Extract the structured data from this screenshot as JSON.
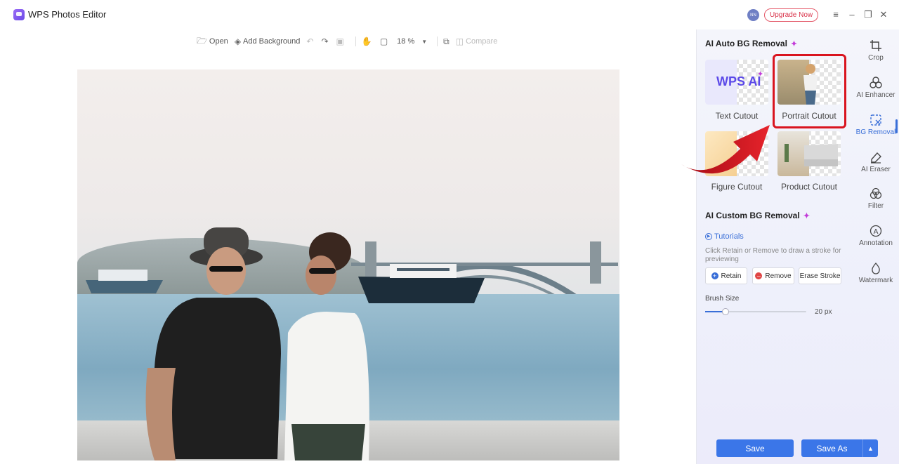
{
  "app": {
    "title": "WPS Photos Editor",
    "avatar_initials": "NN",
    "upgrade_label": "Upgrade Now",
    "window_controls": [
      "menu-icon",
      "minimize-icon",
      "restore-icon",
      "close-icon"
    ]
  },
  "toolbar": {
    "open_label": "Open",
    "add_background_label": "Add Background",
    "zoom_value": "18 %",
    "compare_label": "Compare",
    "icons": [
      "open-icon",
      "add-background-icon",
      "undo-icon",
      "redo-icon",
      "image-icon",
      "hand-icon",
      "fit-icon",
      "zoom-dropdown-icon",
      "copy-icon",
      "compare-icon"
    ]
  },
  "panel": {
    "auto_title": "AI Auto BG Removal",
    "options": [
      {
        "label": "Text Cutout",
        "thumb_text": "WPS AI"
      },
      {
        "label": "Portrait Cutout"
      },
      {
        "label": "Figure Cutout"
      },
      {
        "label": "Product Cutout"
      }
    ],
    "custom_title": "AI Custom BG Removal",
    "tutorials_label": "Tutorials",
    "hint": "Click Retain or Remove to draw a stroke for previewing",
    "retain_label": "Retain",
    "remove_label": "Remove",
    "erase_label": "Erase Stroke",
    "brush_label": "Brush Size",
    "brush_value": "20 px",
    "brush_fraction": 0.2
  },
  "rail": {
    "items": [
      {
        "label": "Crop",
        "icon": "crop-icon"
      },
      {
        "label": "AI Enhancer",
        "icon": "ai-enhancer-icon"
      },
      {
        "label": "BG Removal",
        "icon": "bg-removal-icon",
        "active": true
      },
      {
        "label": "AI Eraser",
        "icon": "eraser-icon"
      },
      {
        "label": "Filter",
        "icon": "filter-icon"
      },
      {
        "label": "Annotation",
        "icon": "annotation-icon"
      },
      {
        "label": "Watermark",
        "icon": "watermark-icon"
      }
    ]
  },
  "footer": {
    "save_label": "Save",
    "save_as_label": "Save As"
  },
  "colors": {
    "accent": "#3b76e8",
    "highlight": "#d9141f",
    "sparkle": "#c23ad8"
  }
}
